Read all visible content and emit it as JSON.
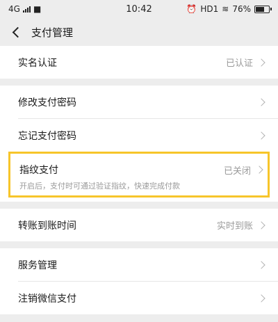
{
  "status": {
    "network": "4G",
    "time": "10:42",
    "hd": "HD1",
    "battery": "76%",
    "battery_level": 0.76
  },
  "nav": {
    "title": "支付管理"
  },
  "rows": {
    "realname": {
      "label": "实名认证",
      "value": "已认证"
    },
    "modify_pwd": {
      "label": "修改支付密码"
    },
    "forgot_pwd": {
      "label": "忘记支付密码"
    },
    "fingerprint": {
      "label": "指纹支付",
      "value": "已关闭",
      "desc": "开启后，支付时可通过验证指纹，快速完成付款"
    },
    "transfer_time": {
      "label": "转账到账时间",
      "value": "实时到账"
    },
    "service": {
      "label": "服务管理"
    },
    "deregister": {
      "label": "注销微信支付"
    }
  },
  "colors": {
    "highlight": "#f7c52a",
    "background": "#ededed"
  }
}
